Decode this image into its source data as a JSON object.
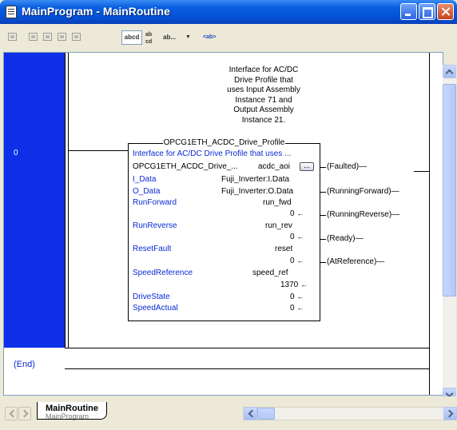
{
  "window": {
    "title": "MainProgram - MainRoutine",
    "buttons": [
      "minimize",
      "maximize",
      "close"
    ]
  },
  "toolbar": {
    "items": [
      {
        "type": "icon",
        "name": "rung-icon"
      },
      {
        "type": "icon",
        "name": "branch-icon"
      },
      {
        "type": "icon",
        "name": "branch-level-icon"
      },
      {
        "type": "icon",
        "name": "xic-icon"
      },
      {
        "type": "icon",
        "name": "xio-icon"
      },
      {
        "type": "label",
        "text": "abcd"
      },
      {
        "type": "label",
        "text": "ab cd"
      },
      {
        "type": "dropdown",
        "text": "ab..."
      },
      {
        "type": "tag",
        "text": "<ab>"
      }
    ]
  },
  "ladder": {
    "rung_number": "0",
    "end_label": "(End)",
    "description": "Interface for AC/DC\nDrive Profile that\nuses Input Assembly\nInstance 71 and\nOutput Assembly\nInstance 21.",
    "block": {
      "name": "OPCG1ETH_ACDC_Drive_Profile",
      "desc_line": "Interface for AC/DC Drive Profile that uses ...",
      "type_line": "OPCG1ETH_ACDC_Drive_...",
      "instance": "acdc_aoi",
      "ellipsis_label": "...",
      "params": [
        {
          "name": "I_Data",
          "value": "Fuji_Inverter:I.Data",
          "num": ""
        },
        {
          "name": "O_Data",
          "value": "Fuji_Inverter:O.Data",
          "num": ""
        },
        {
          "name": "RunForward",
          "value": "run_fwd",
          "num": "0"
        },
        {
          "name": "RunReverse",
          "value": "run_rev",
          "num": "0"
        },
        {
          "name": "ResetFault",
          "value": "reset",
          "num": "0"
        },
        {
          "name": "SpeedReference",
          "value": "speed_ref",
          "num": "1370"
        },
        {
          "name": "DriveState",
          "value": "",
          "num": "0"
        },
        {
          "name": "SpeedActual",
          "value": "",
          "num": "0"
        }
      ],
      "outputs": [
        "Faulted",
        "RunningForward",
        "RunningReverse",
        "Ready",
        "AtReference"
      ]
    }
  },
  "tabs": [
    {
      "title": "MainRoutine",
      "subtitle": "MainProgram"
    }
  ]
}
